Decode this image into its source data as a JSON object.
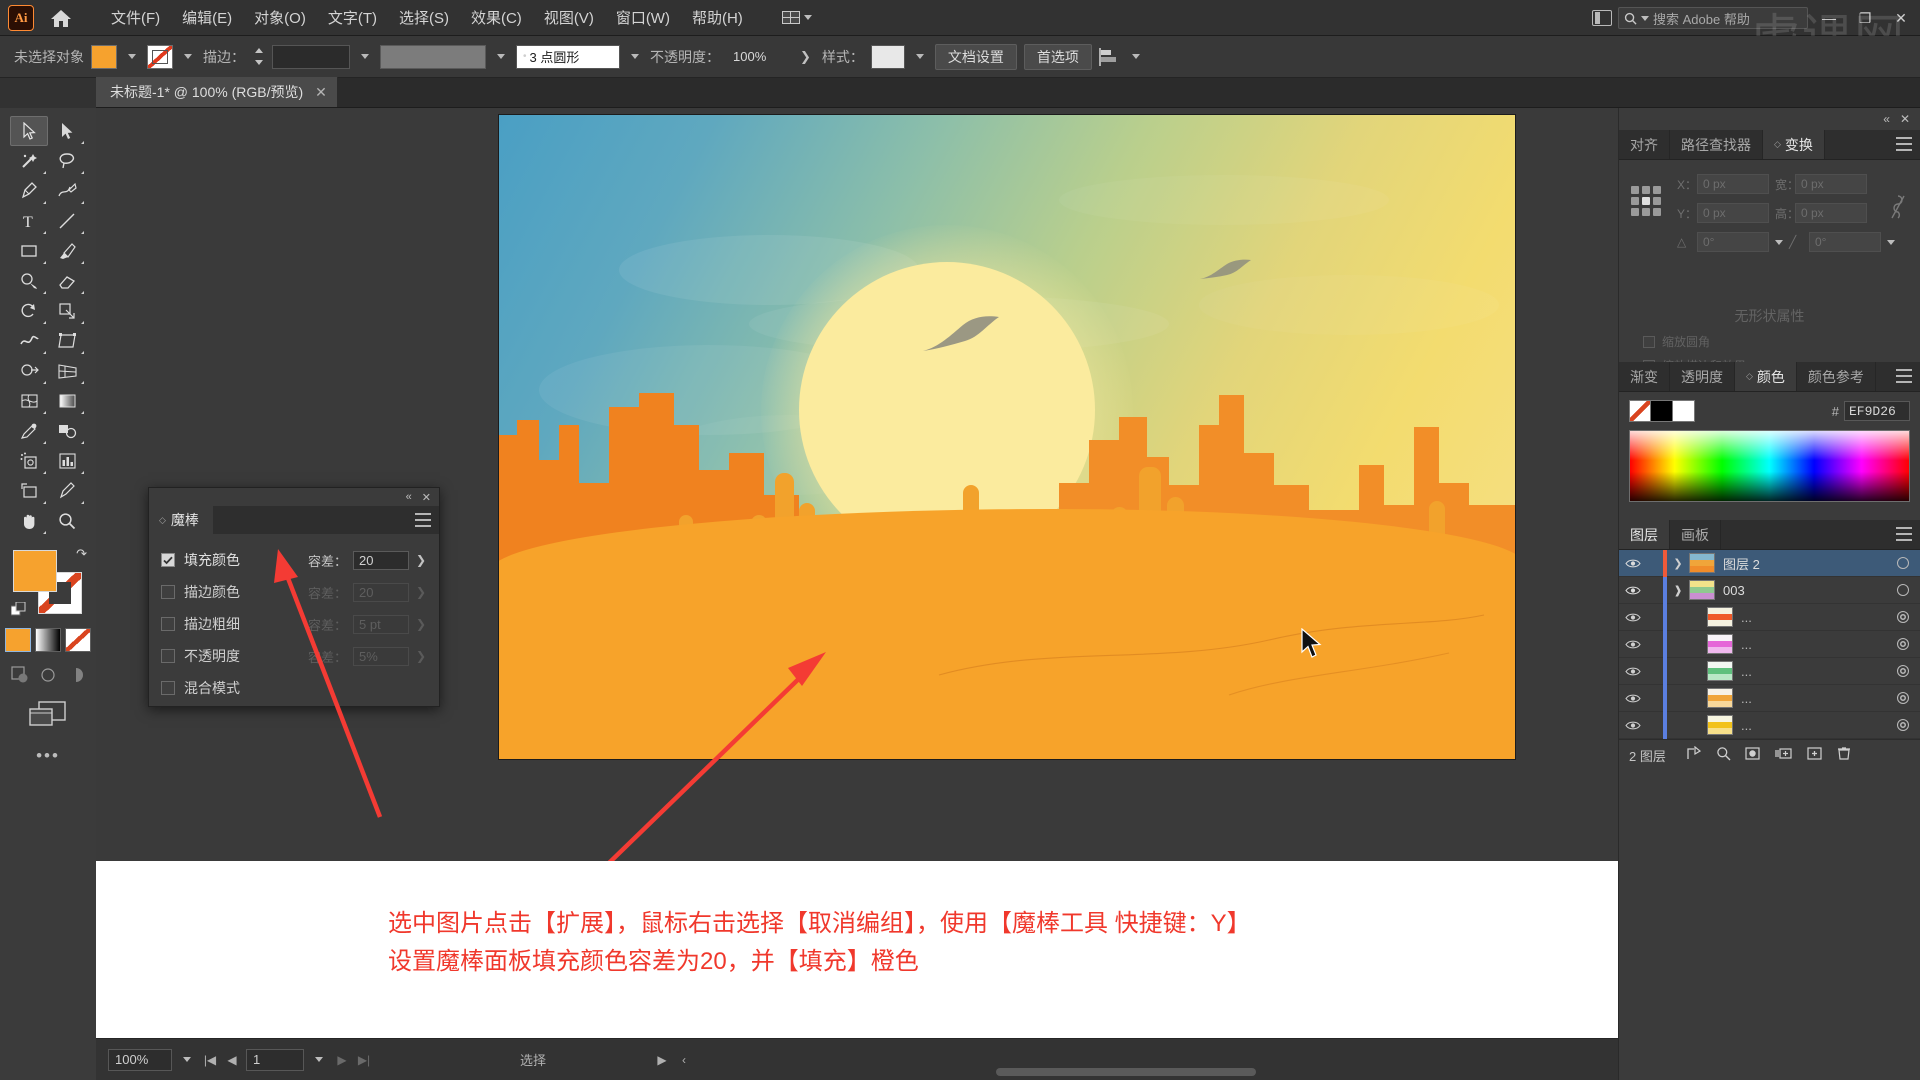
{
  "app": {
    "name": "Adobe Illustrator",
    "logo_text": "Ai",
    "home_icon": "home-icon"
  },
  "menubar": {
    "items": [
      {
        "label": "文件(F)"
      },
      {
        "label": "编辑(E)"
      },
      {
        "label": "对象(O)"
      },
      {
        "label": "文字(T)"
      },
      {
        "label": "选择(S)"
      },
      {
        "label": "效果(C)"
      },
      {
        "label": "视图(V)"
      },
      {
        "label": "窗口(W)"
      },
      {
        "label": "帮助(H)"
      }
    ],
    "search_placeholder": "搜索 Adobe 帮助",
    "window_buttons": [
      "—",
      "❐",
      "✕"
    ],
    "watermark": "虎课网"
  },
  "controlbar": {
    "selection_status": "未选择对象",
    "fill_color": "#F6A22E",
    "stroke_color": "无",
    "stroke_label": "描边：",
    "stroke_weight": "",
    "brush_definition": "3 点圆形",
    "opacity_label": "不透明度：",
    "opacity_value": "100%",
    "style_label": "样式：",
    "document_setup": "文档设置",
    "preferences": "首选项"
  },
  "document": {
    "tab_title": "未标题-1* @ 100% (RGB/预览)",
    "close_glyph": "✕"
  },
  "toolbar": {
    "tools": [
      {
        "name": "selection-tool",
        "active": true
      },
      {
        "name": "direct-selection-tool",
        "active": false
      },
      {
        "name": "magic-wand-tool",
        "active": false
      },
      {
        "name": "lasso-tool",
        "active": false
      },
      {
        "name": "pen-tool",
        "active": false
      },
      {
        "name": "curvature-tool",
        "active": false
      },
      {
        "name": "type-tool",
        "active": false
      },
      {
        "name": "line-segment-tool",
        "active": false
      },
      {
        "name": "rectangle-tool",
        "active": false
      },
      {
        "name": "paintbrush-tool",
        "active": false
      },
      {
        "name": "shaper-tool",
        "active": false
      },
      {
        "name": "eraser-tool",
        "active": false
      },
      {
        "name": "rotate-tool",
        "active": false
      },
      {
        "name": "scale-tool",
        "active": false
      },
      {
        "name": "width-tool",
        "active": false
      },
      {
        "name": "free-transform-tool",
        "active": false
      },
      {
        "name": "shape-builder-tool",
        "active": false
      },
      {
        "name": "perspective-grid-tool",
        "active": false
      },
      {
        "name": "mesh-tool",
        "active": false
      },
      {
        "name": "gradient-tool",
        "active": false
      },
      {
        "name": "eyedropper-tool",
        "active": false
      },
      {
        "name": "blend-tool",
        "active": false
      },
      {
        "name": "symbol-sprayer-tool",
        "active": false
      },
      {
        "name": "column-graph-tool",
        "active": false
      },
      {
        "name": "artboard-tool",
        "active": false
      },
      {
        "name": "slice-tool",
        "active": false
      },
      {
        "name": "hand-tool",
        "active": false
      },
      {
        "name": "zoom-tool",
        "active": false
      }
    ],
    "fill_swatch": "#F6A22E",
    "stroke_swatch": "none",
    "more_tools": "•••"
  },
  "magic_wand_panel": {
    "title": "魔棒",
    "collapse_glyph": "«",
    "close_glyph": "✕",
    "rows": [
      {
        "label": "填充颜色",
        "checked": true,
        "tol_label": "容差：",
        "tol_value": "20",
        "enabled": true
      },
      {
        "label": "描边颜色",
        "checked": false,
        "tol_label": "容差：",
        "tol_value": "20",
        "enabled": false
      },
      {
        "label": "描边粗细",
        "checked": false,
        "tol_label": "容差：",
        "tol_value": "5 pt",
        "enabled": false
      },
      {
        "label": "不透明度",
        "checked": false,
        "tol_label": "容差：",
        "tol_value": "5%",
        "enabled": false
      },
      {
        "label": "混合模式",
        "checked": false,
        "tol_label": "",
        "tol_value": "",
        "enabled": false
      }
    ]
  },
  "transform_panel": {
    "tabs": [
      {
        "label": "对齐",
        "active": false
      },
      {
        "label": "路径查找器",
        "active": false
      },
      {
        "label": "变换",
        "active": true
      }
    ],
    "fields": [
      {
        "label": "X：",
        "value": "0 px"
      },
      {
        "label": "宽：",
        "value": "0 px"
      },
      {
        "label": "Y：",
        "value": "0 px"
      },
      {
        "label": "高：",
        "value": "0 px"
      }
    ],
    "angle_value": "0°",
    "shear_value": "0°",
    "empty_message": "无形状属性",
    "checkboxes": [
      {
        "label": "缩放圆角"
      },
      {
        "label": "缩放描边和效果"
      }
    ]
  },
  "color_panel": {
    "tabs": [
      {
        "label": "渐变",
        "active": false
      },
      {
        "label": "透明度",
        "active": false
      },
      {
        "label": "颜色",
        "active": true
      },
      {
        "label": "颜色参考",
        "active": false
      }
    ],
    "hex_prefix": "#",
    "hex_value": "EF9D26",
    "swatches": [
      "none",
      "#000000",
      "#FFFFFF"
    ]
  },
  "layers_panel": {
    "tabs": [
      {
        "label": "图层",
        "active": true
      },
      {
        "label": "画板",
        "active": false
      }
    ],
    "rows": [
      {
        "name": "图层 2",
        "selected": true,
        "indent": 0,
        "expanded": false,
        "thumb": [
          "#84b7cf",
          "#f0a53a",
          "#f08c2a"
        ],
        "color": "#ef5a3a"
      },
      {
        "name": "003",
        "selected": false,
        "indent": 1,
        "expanded": true,
        "thumb": [
          "#f2e28a",
          "#8fc98f",
          "#c98fd0"
        ],
        "color": "#5b7fe0"
      },
      {
        "name": "...",
        "selected": false,
        "indent": 2,
        "expanded": null,
        "thumb": [
          "#f5f2e0",
          "#ef5a2a",
          "#f5f2e0"
        ],
        "color": "#5b7fe0"
      },
      {
        "name": "...",
        "selected": false,
        "indent": 2,
        "expanded": null,
        "thumb": [
          "#f7f2f7",
          "#e566d8",
          "#f0b8ee"
        ],
        "color": "#5b7fe0"
      },
      {
        "name": "...",
        "selected": false,
        "indent": 2,
        "expanded": null,
        "thumb": [
          "#f2f7f2",
          "#5fc07d",
          "#b9e8c6"
        ],
        "color": "#5b7fe0"
      },
      {
        "name": "...",
        "selected": false,
        "indent": 2,
        "expanded": null,
        "thumb": [
          "#f7f2e6",
          "#f0a53a",
          "#f7d79a"
        ],
        "color": "#5b7fe0"
      },
      {
        "name": "...",
        "selected": false,
        "indent": 2,
        "expanded": null,
        "thumb": [
          "#f7f5e0",
          "#f2c21a",
          "#f7e08a"
        ],
        "color": "#5b7fe0"
      }
    ],
    "footer_count": "2 图层",
    "footer_icons": [
      "release-icon",
      "locate-icon",
      "make-mask-icon",
      "new-sublayer-icon",
      "new-layer-icon",
      "delete-layer-icon"
    ]
  },
  "note": {
    "line1": "选中图片点击【扩展】，鼠标右击选择【取消编组】，使用【魔棒工具 快捷键：Y】",
    "line2": "设置魔棒面板填充颜色容差为20，并【填充】橙色",
    "color": "#F0382C"
  },
  "statusbar": {
    "zoom": "100%",
    "page": "1",
    "tool_status": "选择",
    "nav_first": "|◀",
    "nav_prev": "◀",
    "nav_next": "▶",
    "nav_last": "▶|",
    "more_glyph": "▶",
    "expand_glyph": "‹"
  },
  "artwork": {
    "title": "desert-sunset-illustration",
    "sky_top": "#4A9FC4",
    "sky_bottom": "#F7E08A",
    "sun": "#FBEB9E",
    "sand": "#F7A32A",
    "mesa_light": "#F08A2A",
    "mesa_dark": "#C05A16",
    "cactus": "#F2A22C"
  }
}
